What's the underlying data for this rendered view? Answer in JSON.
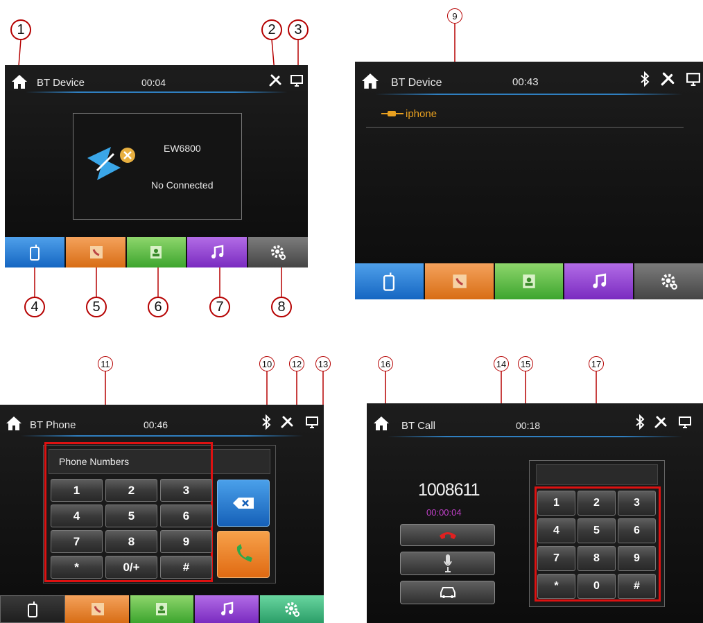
{
  "panel1": {
    "title": "BT Device",
    "time": "00:04",
    "device_name": "EW6800",
    "status": "No Connected"
  },
  "panel2": {
    "title": "BT Device",
    "time": "00:43",
    "paired_device": "iphone"
  },
  "panel3": {
    "title": "BT Phone",
    "time": "00:46",
    "number_placeholder": "Phone Numbers",
    "keys": [
      "1",
      "2",
      "3",
      "4",
      "5",
      "6",
      "7",
      "8",
      "9",
      "*",
      "0/+",
      "#"
    ]
  },
  "panel4": {
    "title": "BT Call",
    "time": "00:18",
    "number": "1008611",
    "duration": "00:00:04",
    "keys": [
      "1",
      "2",
      "3",
      "4",
      "5",
      "6",
      "7",
      "8",
      "9",
      "*",
      "0",
      "#"
    ]
  },
  "callouts": [
    "1",
    "2",
    "3",
    "4",
    "5",
    "6",
    "7",
    "8",
    "9",
    "10",
    "11",
    "12",
    "13",
    "14",
    "15",
    "16",
    "17"
  ],
  "colors": {
    "accent": "#2f7fc0",
    "callout": "#b50000",
    "tab_phone": "#1566c2",
    "tab_contacts": "#d86d15",
    "tab_book": "#3da52e",
    "tab_music": "#7a2bc0",
    "tab_settings": "#454545",
    "call_green": "#2ea84a",
    "call_red": "#e02020"
  },
  "icons": [
    "home-icon",
    "tools-icon",
    "display-icon",
    "bluetooth-icon",
    "phone-icon",
    "contacts-icon",
    "phonebook-icon",
    "music-icon",
    "settings-icon",
    "backspace-icon",
    "call-icon",
    "hangup-icon",
    "mic-icon",
    "car-icon"
  ]
}
